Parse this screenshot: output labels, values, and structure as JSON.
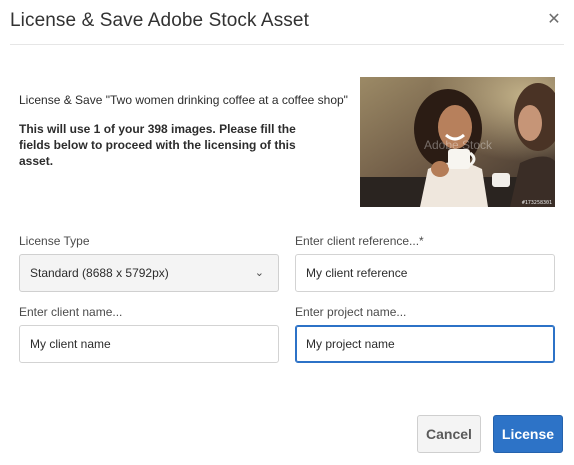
{
  "dialog": {
    "title": "License & Save Adobe Stock Asset",
    "close_icon": "close-icon"
  },
  "message": {
    "lead": "License & Save \"Two women drinking coffee at a coffee shop\"",
    "bold": "This will use 1 of your 398 images. Please fill the fields below to proceed with the licensing of this asset."
  },
  "thumbnail": {
    "watermark": "Adobe Stock",
    "stock_id": "#173258301"
  },
  "form": {
    "license_type": {
      "label": "License Type",
      "value": "Standard (8688 x 5792px)",
      "icon": "chevron-down-icon"
    },
    "client_reference": {
      "label": "Enter client reference...*",
      "value": "My client reference"
    },
    "client_name": {
      "label": "Enter client name...",
      "value": "My client name"
    },
    "project_name": {
      "label": "Enter project name...",
      "value": "My project name"
    }
  },
  "buttons": {
    "cancel": "Cancel",
    "license": "License"
  },
  "colors": {
    "accent": "#2d73c7",
    "focus_border": "#2c72c7"
  }
}
